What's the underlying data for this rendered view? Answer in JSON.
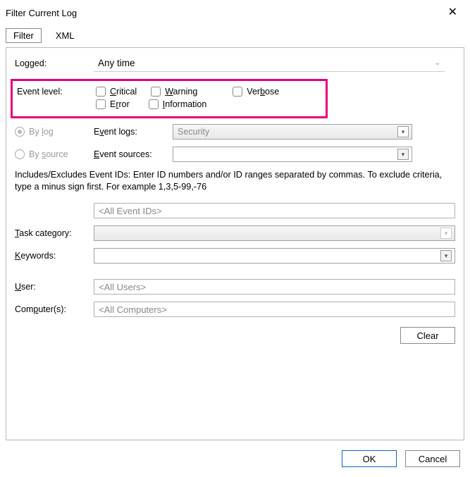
{
  "window": {
    "title": "Filter Current Log"
  },
  "tabs": {
    "filter": "Filter",
    "xml": "XML"
  },
  "labels": {
    "logged": "Logged:",
    "event_level": "Event level:",
    "by_log_label": "By log",
    "by_log_prefix": "By ",
    "by_log_u": "l",
    "by_log_suffix": "og",
    "by_source_prefix": "By ",
    "by_source_u": "s",
    "by_source_suffix": "ource",
    "event_logs_pre": "E",
    "event_logs_u": "v",
    "event_logs_post": "ent logs:",
    "event_sources_pre": "",
    "event_sources_u": "E",
    "event_sources_post": "vent sources:",
    "task_cat_u": "T",
    "task_cat_post": "ask category:",
    "keywords_u": "K",
    "keywords_post": "eywords:",
    "user_u": "U",
    "user_post": "ser:",
    "computers_pre": "Com",
    "computers_u": "p",
    "computers_post": "uter(s):"
  },
  "logged_value": "Any time",
  "levels": {
    "critical_u": "C",
    "critical_post": "ritical",
    "warning_u": "W",
    "warning_post": "arning",
    "verbose_pre": "Ver",
    "verbose_u": "b",
    "verbose_post": "ose",
    "error_pre": "E",
    "error_u": "r",
    "error_post": "ror",
    "info_u": "I",
    "info_post": "nformation"
  },
  "event_logs_value": "Security",
  "event_sources_value": "",
  "help_text": "Includes/Excludes Event IDs: Enter ID numbers and/or ID ranges separated by commas. To exclude criteria, type a minus sign first. For example 1,3,5-99,-76",
  "event_ids_placeholder": "<All Event IDs>",
  "task_category_value": "",
  "keywords_value": "",
  "user_placeholder": "<All Users>",
  "computers_placeholder": "<All Computers>",
  "buttons": {
    "clear": "Clear",
    "ok": "OK",
    "cancel": "Cancel"
  }
}
